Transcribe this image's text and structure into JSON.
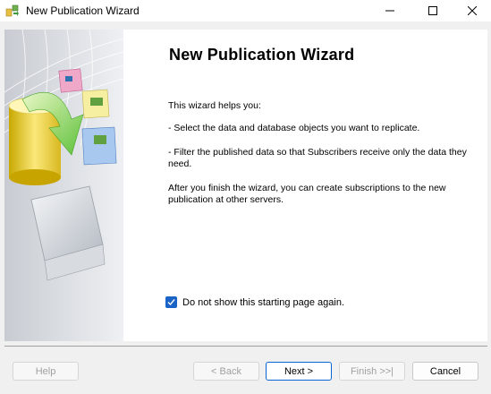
{
  "window": {
    "title": "New Publication Wizard",
    "icon": "publication-wizard-icon"
  },
  "main": {
    "heading": "New Publication Wizard",
    "intro": "This wizard helps you:",
    "bullet_1": " - Select the data and database objects you want to replicate.",
    "bullet_2": " - Filter the published data so that Subscribers receive only the data they need.",
    "after": " After you finish the wizard, you can create subscriptions to the new publication at other servers."
  },
  "options": {
    "skip_start_label": "Do not show this starting page again.",
    "skip_start_checked": true
  },
  "buttons": {
    "help": "Help",
    "back": "< Back",
    "next": "Next >",
    "finish": "Finish >>|",
    "cancel": "Cancel"
  },
  "colors": {
    "accent": "#1a64c8",
    "primary_border": "#0a64d6"
  }
}
